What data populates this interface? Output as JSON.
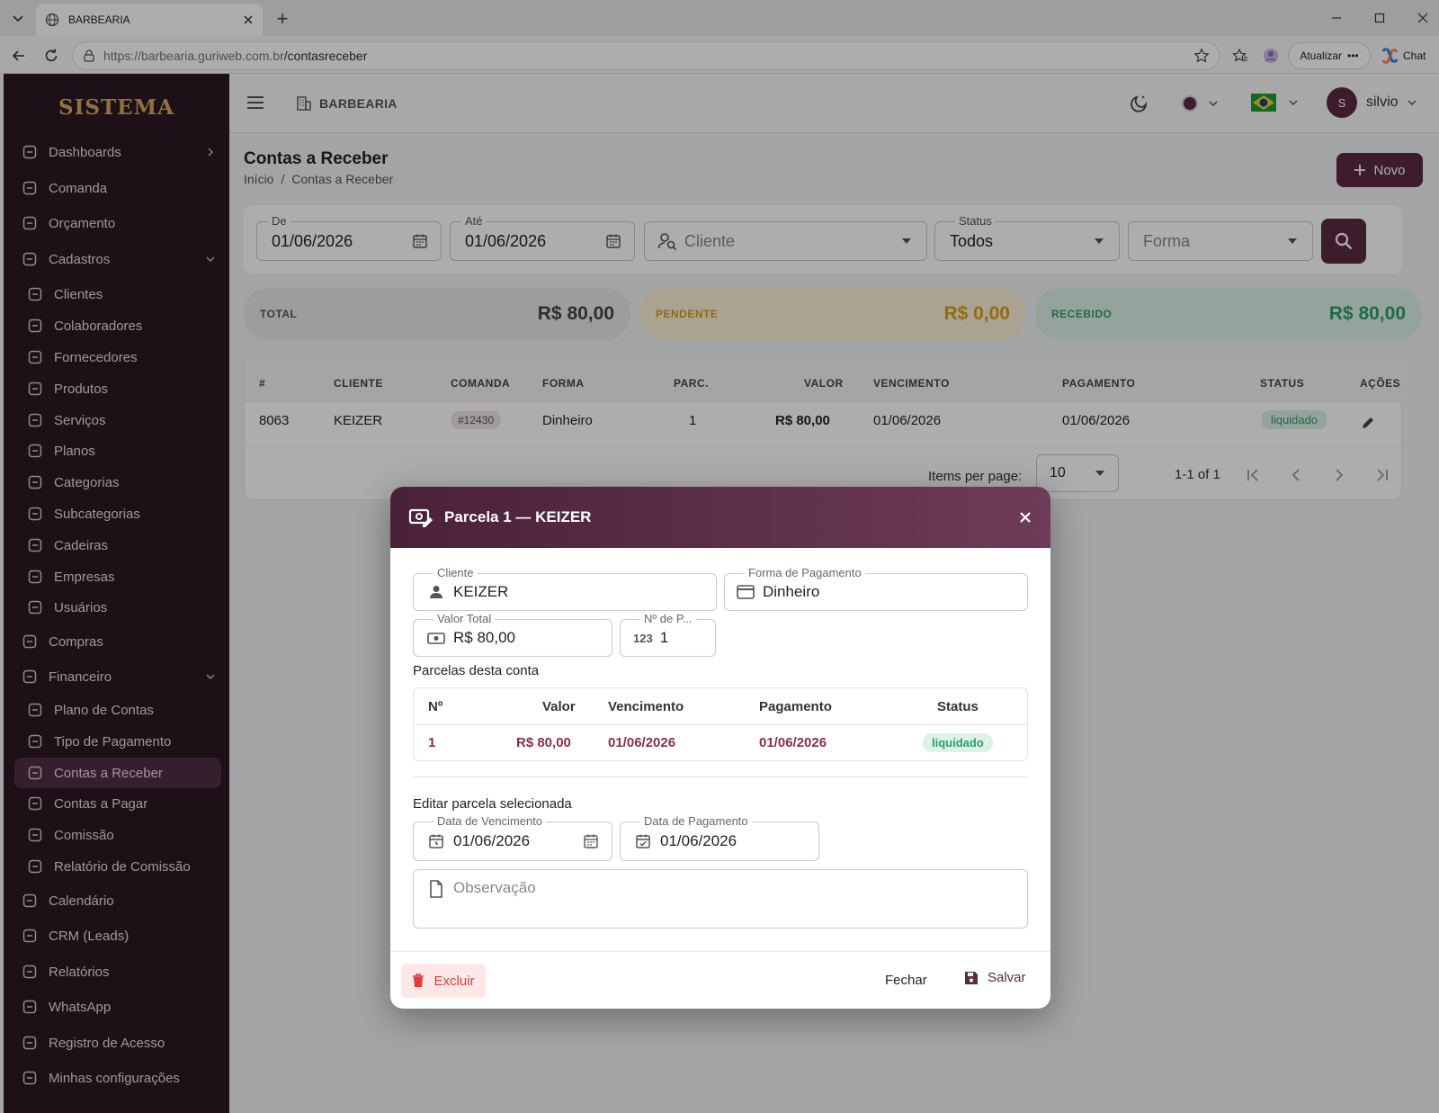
{
  "browser": {
    "tab_title": "BARBEARIA",
    "url_host": "https://barbearia.guriweb.com.br",
    "url_path": "/contasreceber",
    "update_label": "Atualizar",
    "chat_label": "Chat"
  },
  "sidebar": {
    "brand": "SISTEMA",
    "items": [
      {
        "label": "Dashboards",
        "icon": "dashboard-icon"
      },
      {
        "label": "Comanda",
        "icon": "clipboard-icon"
      },
      {
        "label": "Orçamento",
        "icon": "document-edit-icon"
      },
      {
        "label": "Cadastros",
        "icon": "database-icon"
      },
      {
        "label": "Clientes",
        "icon": "users-icon"
      },
      {
        "label": "Colaboradores",
        "icon": "person-icon"
      },
      {
        "label": "Fornecedores",
        "icon": "truck-icon"
      },
      {
        "label": "Produtos",
        "icon": "box-icon"
      },
      {
        "label": "Serviços",
        "icon": "scissors-icon"
      },
      {
        "label": "Planos",
        "icon": "plan-icon"
      },
      {
        "label": "Categorias",
        "icon": "tag-icon"
      },
      {
        "label": "Subcategorias",
        "icon": "tags-icon"
      },
      {
        "label": "Cadeiras",
        "icon": "chair-icon"
      },
      {
        "label": "Empresas",
        "icon": "building-icon"
      },
      {
        "label": "Usuários",
        "icon": "user-gear-icon"
      },
      {
        "label": "Compras",
        "icon": "cart-icon"
      },
      {
        "label": "Financeiro",
        "icon": "money-icon"
      },
      {
        "label": "Plano de Contas",
        "icon": "sitemap-icon"
      },
      {
        "label": "Tipo de Pagamento",
        "icon": "card-icon"
      },
      {
        "label": "Contas a Receber",
        "icon": "cash-in-icon"
      },
      {
        "label": "Contas a Pagar",
        "icon": "cash-out-icon"
      },
      {
        "label": "Comissão",
        "icon": "commission-icon"
      },
      {
        "label": "Relatório de Comissão",
        "icon": "chart-line-icon"
      },
      {
        "label": "Calendário",
        "icon": "calendar-icon"
      },
      {
        "label": "CRM (Leads)",
        "icon": "crm-icon"
      },
      {
        "label": "Relatórios",
        "icon": "report-icon"
      },
      {
        "label": "WhatsApp",
        "icon": "whatsapp-icon"
      },
      {
        "label": "Registro de Acesso",
        "icon": "shield-icon"
      },
      {
        "label": "Minhas configurações",
        "icon": "gear-icon"
      }
    ]
  },
  "topbar": {
    "company": "BARBEARIA",
    "user_initial": "S",
    "user_name": "silvio"
  },
  "page": {
    "title": "Contas a Receber",
    "breadcrumb_home": "Início",
    "breadcrumb_sep": "/",
    "breadcrumb_current": "Contas a Receber",
    "new_button": "Novo"
  },
  "filters": {
    "from_label": "De",
    "from_value": "01/06/2026",
    "to_label": "Até",
    "to_value": "01/06/2026",
    "client_placeholder": "Cliente",
    "status_label": "Status",
    "status_value": "Todos",
    "forma_placeholder": "Forma"
  },
  "stats": {
    "total_label": "TOTAL",
    "total_value": "R$ 80,00",
    "pending_label": "PENDENTE",
    "pending_value": "R$ 0,00",
    "received_label": "RECEBIDO",
    "received_value": "R$ 80,00"
  },
  "table": {
    "headers": [
      "#",
      "CLIENTE",
      "COMANDA",
      "FORMA",
      "PARC.",
      "VALOR",
      "VENCIMENTO",
      "PAGAMENTO",
      "STATUS",
      "AÇÕES"
    ],
    "row": {
      "id": "8063",
      "cliente": "KEIZER",
      "comanda": "#12430",
      "forma": "Dinheiro",
      "parc": "1",
      "valor": "R$ 80,00",
      "vencimento": "01/06/2026",
      "pagamento": "01/06/2026",
      "status": "liquidado"
    },
    "items_per_page_label": "Items per page:",
    "items_per_page": "10",
    "range": "1-1 of 1"
  },
  "modal": {
    "title": "Parcela 1 — KEIZER",
    "cliente_label": "Cliente",
    "cliente_value": "KEIZER",
    "forma_label": "Forma de Pagamento",
    "forma_value": "Dinheiro",
    "valor_label": "Valor Total",
    "valor_value": "R$ 80,00",
    "nparc_label": "Nº de P...",
    "nparc_icon_text": "123",
    "nparc_value": "1",
    "parcelas_title": "Parcelas desta conta",
    "parcelas_headers": [
      "Nº",
      "Valor",
      "Vencimento",
      "Pagamento",
      "Status"
    ],
    "parcela_row": {
      "n": "1",
      "valor": "R$ 80,00",
      "vencimento": "01/06/2026",
      "pagamento": "01/06/2026",
      "status": "liquidado"
    },
    "edit_title": "Editar parcela selecionada",
    "venc_label": "Data de Vencimento",
    "venc_value": "01/06/2026",
    "pag_label": "Data de Pagamento",
    "pag_value": "01/06/2026",
    "obs_placeholder": "Observação",
    "delete_button": "Excluir",
    "close_button": "Fechar",
    "save_button": "Salvar"
  },
  "colors": {
    "sidebar_bg": "#2d1823",
    "brand_gold": "#d6a75b",
    "accent": "#6e3c58",
    "status_green": "#2e9e6a",
    "pending_yellow": "#d4a017",
    "value_maroon": "#8a2f4a"
  }
}
